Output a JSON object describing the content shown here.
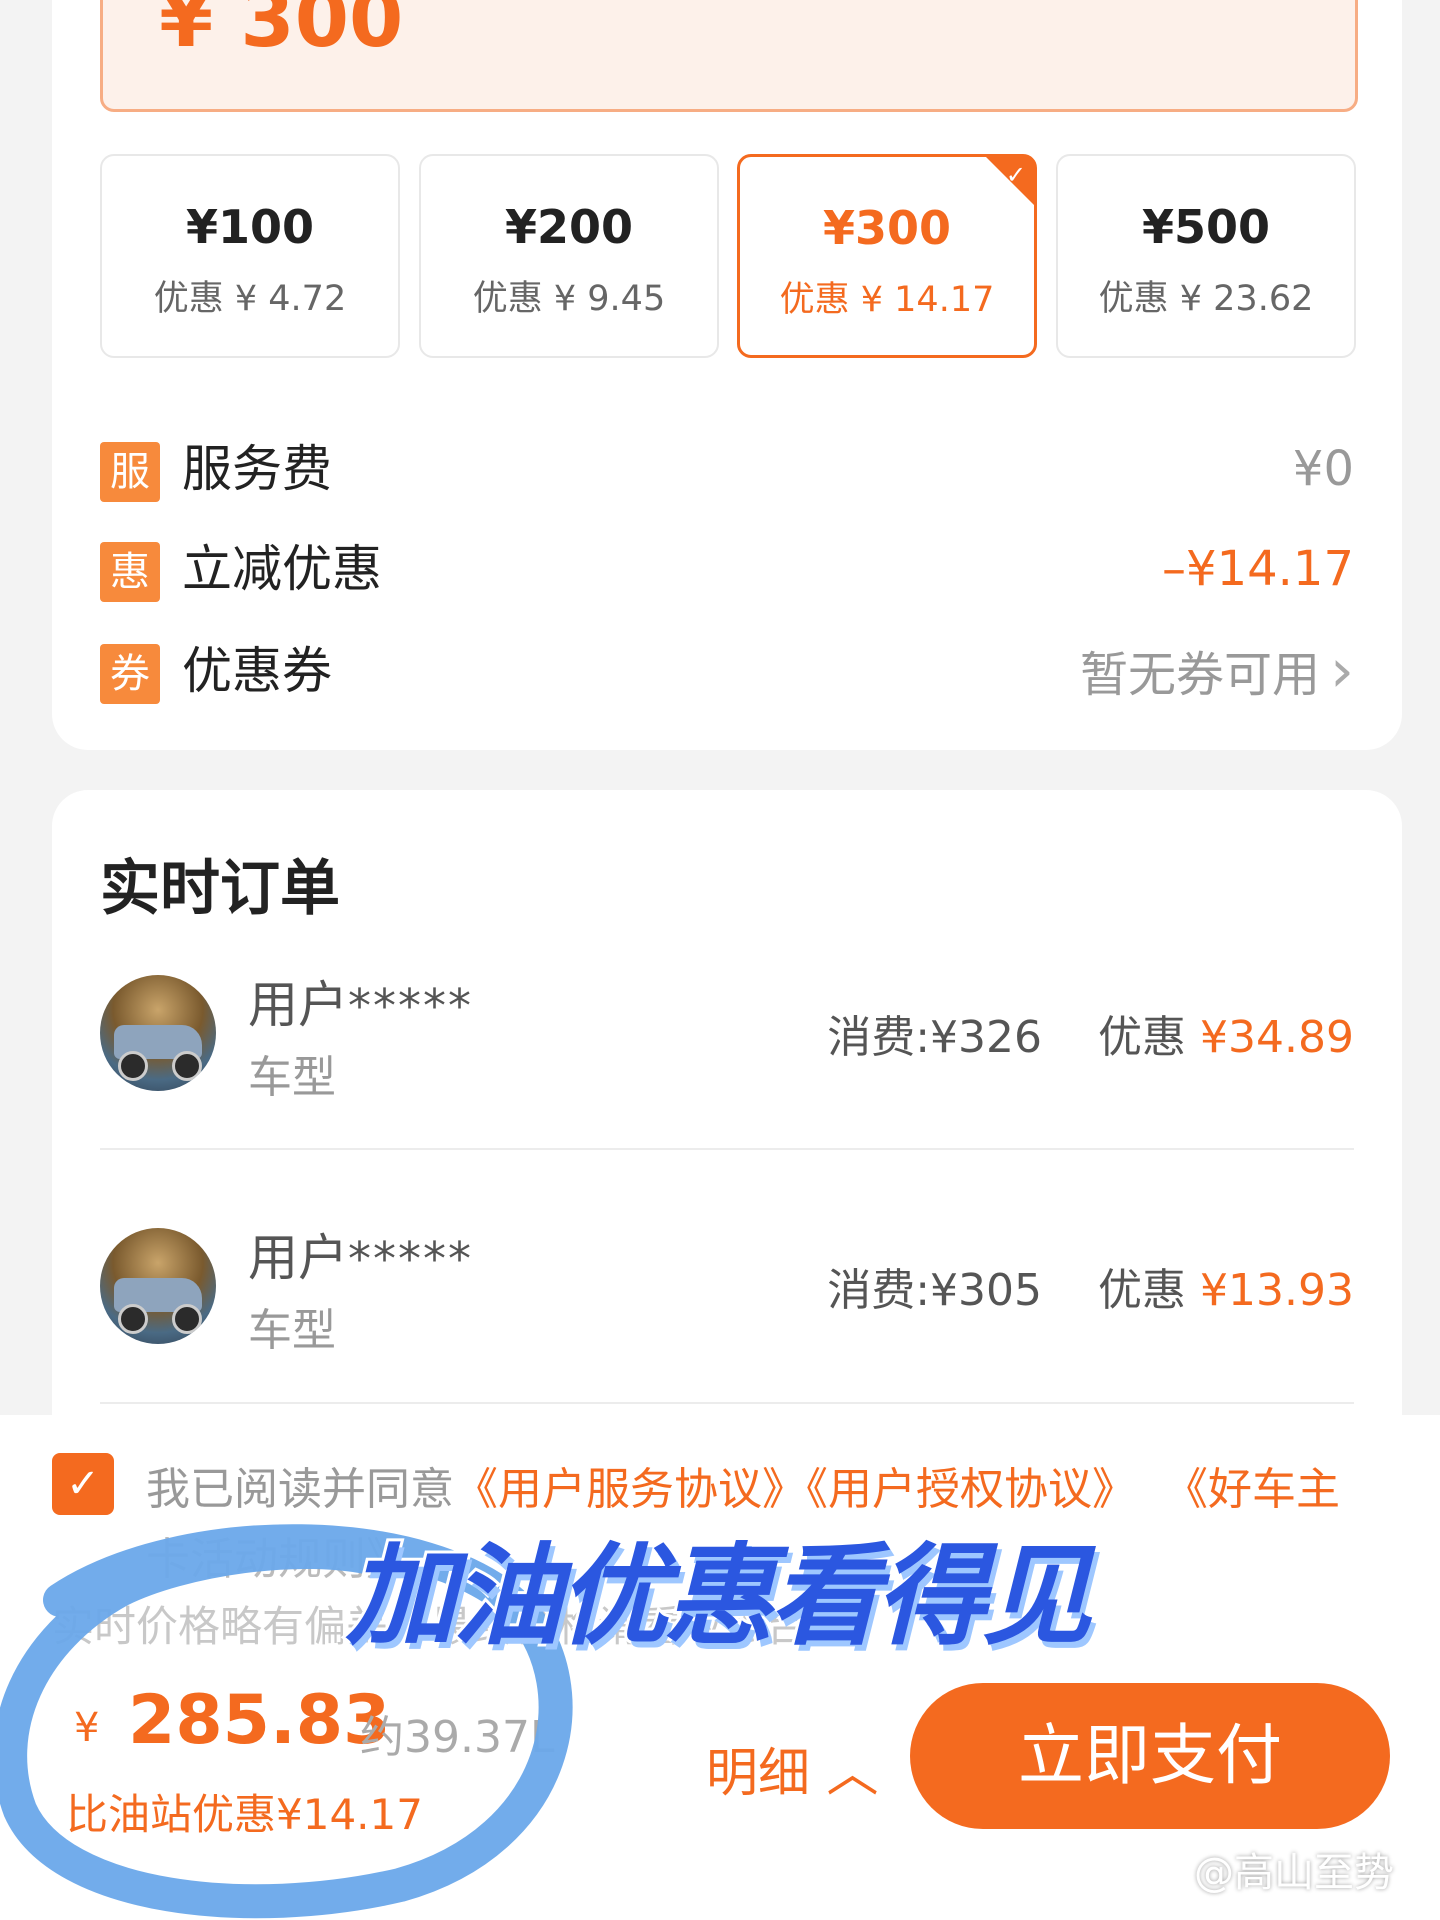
{
  "amount_input": {
    "value": "¥ 300"
  },
  "options": [
    {
      "amount": "¥100",
      "discount": "优惠 ¥ 4.72",
      "selected": false
    },
    {
      "amount": "¥200",
      "discount": "优惠 ¥ 9.45",
      "selected": false
    },
    {
      "amount": "¥300",
      "discount": "优惠 ¥ 14.17",
      "selected": true
    },
    {
      "amount": "¥500",
      "discount": "优惠 ¥ 23.62",
      "selected": false
    }
  ],
  "fees": {
    "service": {
      "badge": "服",
      "label": "服务费",
      "value": "¥0"
    },
    "discount": {
      "badge": "惠",
      "label": "立减优惠",
      "value": "–¥14.17"
    },
    "coupon": {
      "badge": "券",
      "label": "优惠券",
      "value": "暂无券可用"
    }
  },
  "orders": {
    "title": "实时订单",
    "items": [
      {
        "user": "用户",
        "stars": "*****",
        "car": "车型",
        "spend": "消费:¥326",
        "discount_label": "优惠",
        "discount_value": "¥34.89"
      },
      {
        "user": "用户",
        "stars": "*****",
        "car": "车型",
        "spend": "消费:¥305",
        "discount_label": "优惠",
        "discount_value": "¥13.93"
      }
    ]
  },
  "agreement": {
    "prefix": "我已阅读并同意",
    "link1": "《用户服务协议》",
    "link2": "《用户授权协议》",
    "link3": "《好车主",
    "line2": "卡活动规则》",
    "notice": "实时价格略有偏差，最终价格请看收银台"
  },
  "checkout": {
    "currency": "¥",
    "total": "285.83",
    "approx": "约39.37L",
    "saving": "比油站优惠¥14.17",
    "detail": "明细",
    "pay": "立即支付"
  },
  "overlay_caption": "加油优惠看得见",
  "watermark": "@高山至势",
  "colors": {
    "accent": "#f46a1f",
    "badge": "#f78a3c",
    "highlight_circle": "#6aa8ea"
  }
}
